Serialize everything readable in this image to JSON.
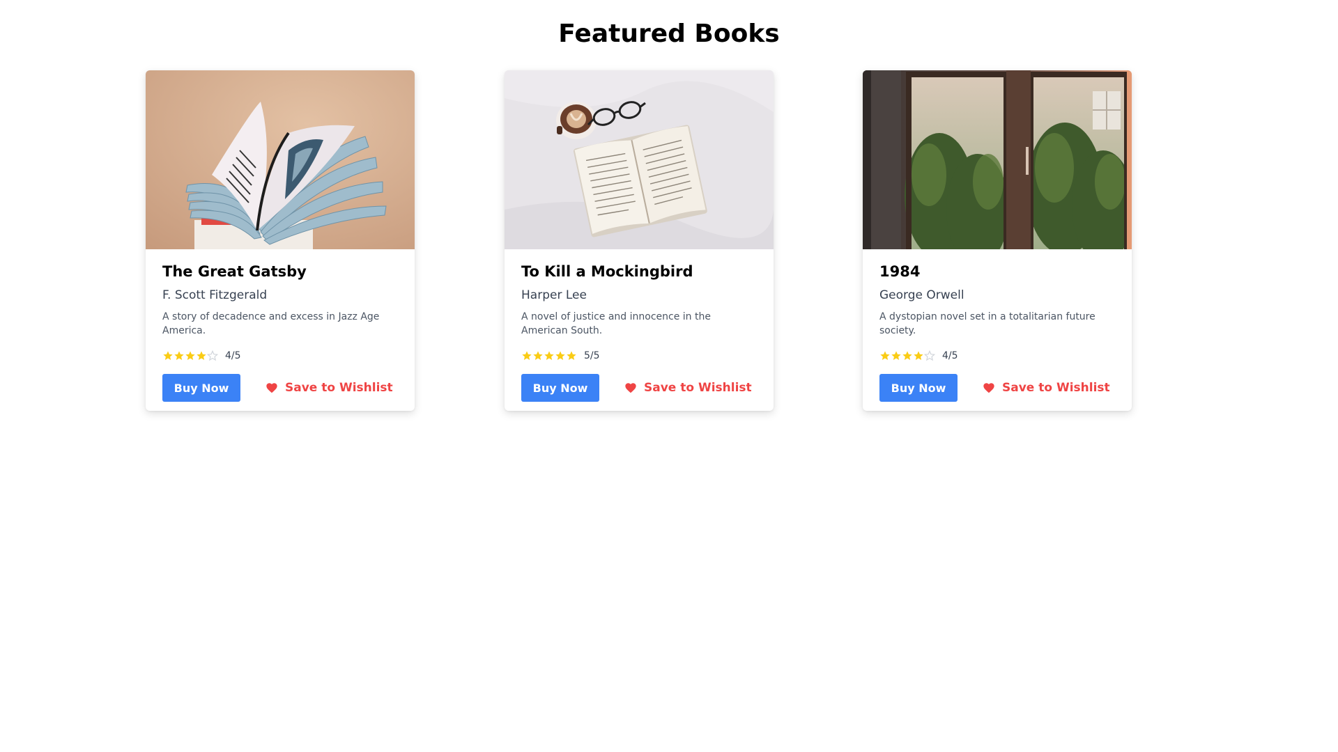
{
  "page": {
    "title": "Featured Books"
  },
  "colors": {
    "accent": "#3b82f6",
    "wishlist": "#ef4444",
    "star_filled": "#facc15",
    "star_empty": "#d1d5db"
  },
  "books": [
    {
      "title": "The Great Gatsby",
      "author": "F. Scott Fitzgerald",
      "description": "A story of decadence and excess in Jazz Age America.",
      "rating": 4,
      "rating_max": 5,
      "rating_text": "4/5",
      "buy_label": "Buy Now",
      "wishlist_label": "Save to Wishlist",
      "image_icon": "open-book-photo-icon"
    },
    {
      "title": "To Kill a Mockingbird",
      "author": "Harper Lee",
      "description": "A novel of justice and innocence in the American South.",
      "rating": 5,
      "rating_max": 5,
      "rating_text": "5/5",
      "buy_label": "Buy Now",
      "wishlist_label": "Save to Wishlist",
      "image_icon": "book-coffee-glasses-photo-icon"
    },
    {
      "title": "1984",
      "author": "George Orwell",
      "description": "A dystopian novel set in a totalitarian future society.",
      "rating": 4,
      "rating_max": 5,
      "rating_text": "4/5",
      "buy_label": "Buy Now",
      "wishlist_label": "Save to Wishlist",
      "image_icon": "window-garden-photo-icon"
    }
  ]
}
